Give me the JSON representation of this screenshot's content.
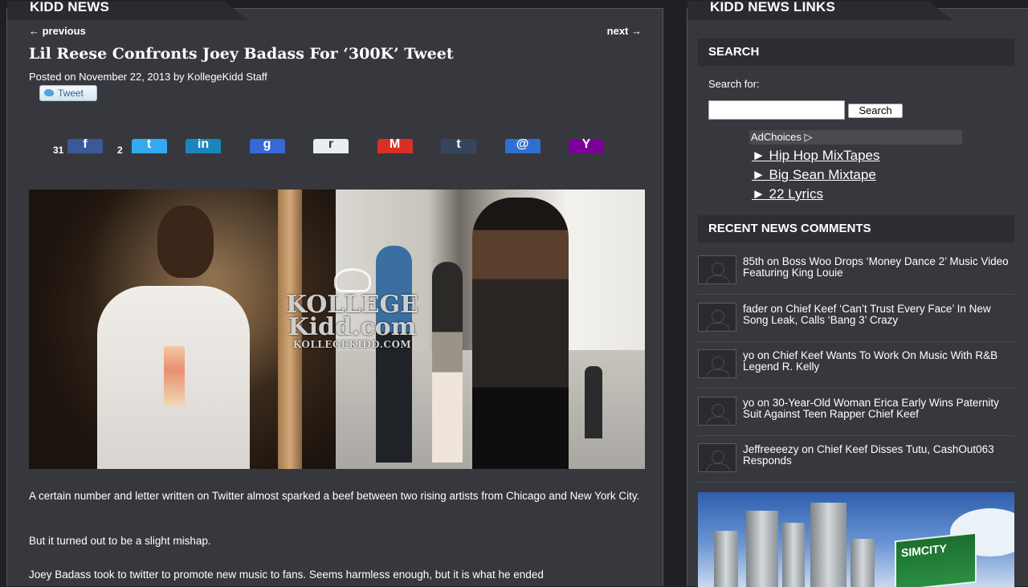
{
  "main": {
    "section_title": "KIDD NEWS",
    "nav": {
      "previous": "← previous",
      "next": "next →"
    },
    "post": {
      "title": "Lil Reese Confronts Joey Badass For ‘300K’ Tweet",
      "posted_on": "Posted on November 22, 2013 by KollegeKidd Staff",
      "tweet_label": "Tweet"
    },
    "share": {
      "facebook_count": "31",
      "twitter_count": "2",
      "buttons": [
        {
          "name": "facebook",
          "glyph": "f",
          "color": "#3b5998"
        },
        {
          "name": "twitter",
          "glyph": "t",
          "color": "#33aaf0"
        },
        {
          "name": "linkedin",
          "glyph": "in",
          "color": "#1b86bc"
        },
        {
          "name": "google",
          "glyph": "g",
          "color": "#3867d6"
        },
        {
          "name": "reddit",
          "glyph": "r",
          "color": "#e9eef2"
        },
        {
          "name": "gmail",
          "glyph": "M",
          "color": "#d93025"
        },
        {
          "name": "tumblr",
          "glyph": "t",
          "color": "#35465c"
        },
        {
          "name": "email",
          "glyph": "@",
          "color": "#2f6fd1"
        },
        {
          "name": "yahoo",
          "glyph": "Y",
          "color": "#7b0099"
        }
      ]
    },
    "watermark": {
      "brand": "KOLLEGE Kidd.com",
      "url": "KOLLEGEKIDD.COM"
    },
    "paragraphs": [
      "A certain number and letter written on Twitter almost sparked a beef between two rising artists from Chicago and New York City.",
      "But it turned out to be a slight mishap.",
      "Joey Badass took to twitter to promote new music to fans. Seems harmless enough, but it is what he ended"
    ]
  },
  "sidebar": {
    "section_title": "KIDD NEWS LINKS",
    "search": {
      "heading": "SEARCH",
      "label": "Search for:",
      "button": "Search",
      "value": ""
    },
    "ads": {
      "choices_label": "AdChoices ▷",
      "links": [
        "► Hip Hop MixTapes",
        "► Big Sean Mixtape",
        "► 22 Lyrics"
      ]
    },
    "recent_comments": {
      "heading": "RECENT NEWS COMMENTS",
      "items": [
        "85th on Boss Woo Drops ‘Money Dance 2’ Music Video Featuring King Louie",
        "fader on Chief Keef ‘Can’t Trust Every Face’ In New Song Leak, Calls ‘Bang 3’ Crazy",
        "yo on Chief Keef Wants To Work On Music With R&B Legend R. Kelly",
        "yo on 30-Year-Old Woman Erica Early Wins Paternity Suit Against Teen Rapper Chief Keef",
        "Jeffreeeezy on Chief Keef Disses Tutu, CashOut063 Responds"
      ]
    },
    "banner": {
      "label": "SIMCITY"
    }
  }
}
